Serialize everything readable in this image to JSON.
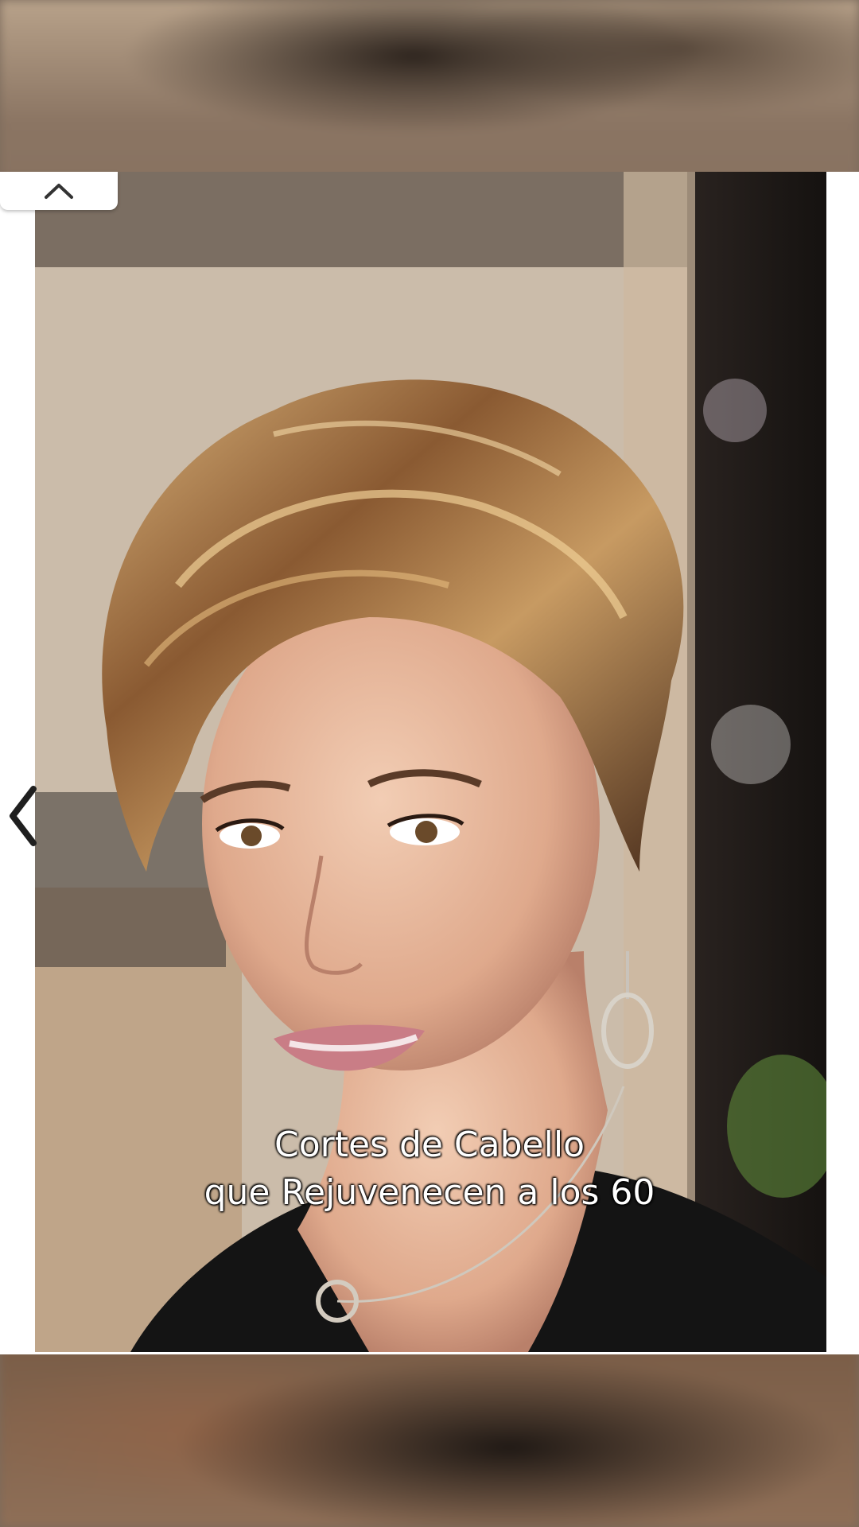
{
  "caption": {
    "line1": "Cortes de Cabello",
    "line2": "que Rejuvenecen a los 60"
  },
  "controls": {
    "collapse_icon": "chevron-up-icon",
    "previous_icon": "chevron-left-icon"
  },
  "colors": {
    "card_background": "#ffffff",
    "caption_text": "#ffffff",
    "caption_outline": "#000000"
  }
}
